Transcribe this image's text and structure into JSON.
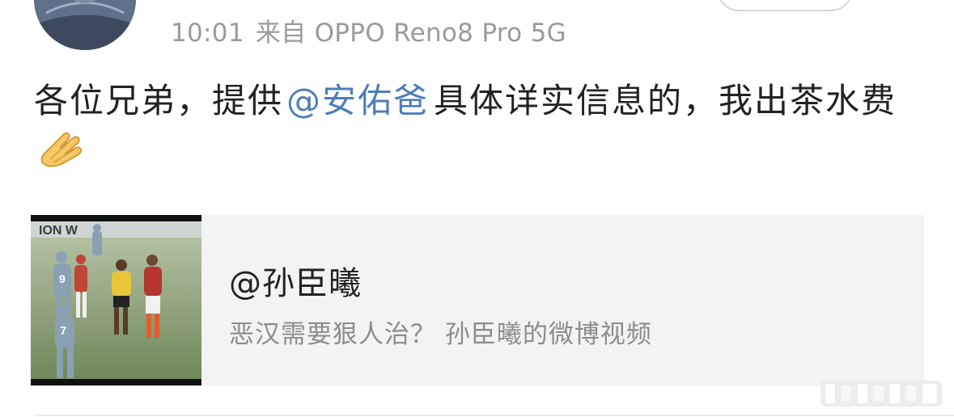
{
  "post": {
    "meta": {
      "time": "10:01",
      "source": "来自 OPPO Reno8 Pro 5G"
    },
    "text": {
      "part1": "各位兄弟，提供",
      "mention": "@安佑爸",
      "part2": "具体详实信息的，我出茶水费",
      "emoji": "palms-together-icon"
    }
  },
  "video_card": {
    "title": "@孙臣曦",
    "description": "恶汉需要狠人治？ 孙臣曦的微博视频",
    "thumbnail": {
      "player_numbers": [
        "9",
        "7"
      ]
    }
  },
  "colors": {
    "mention": "#4d7eb8",
    "meta_text": "#9a9a9a",
    "card_bg": "#f3f3f3"
  }
}
